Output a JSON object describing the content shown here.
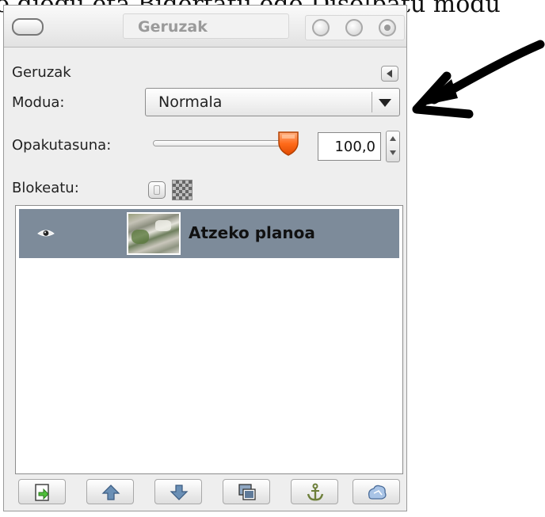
{
  "background_text": "o diogu eta Bidertatu edo Disolbatu modu",
  "window": {
    "title": "Geruzak"
  },
  "panel": {
    "title": "Geruzak",
    "mode_label": "Modua:",
    "mode_value": "Normala",
    "opacity_label": "Opakutasuna:",
    "opacity_value": "100,0",
    "opacity_fraction": 1.0,
    "lock_label": "Blokeatu:"
  },
  "layers": [
    {
      "name": "Atzeko planoa",
      "visible": true,
      "selected": true
    }
  ],
  "bottom_buttons": [
    {
      "icon": "new-layer-icon"
    },
    {
      "icon": "raise-layer-icon"
    },
    {
      "icon": "lower-layer-icon"
    },
    {
      "icon": "duplicate-layer-icon"
    },
    {
      "icon": "anchor-icon"
    },
    {
      "icon": "delete-layer-icon"
    }
  ],
  "colors": {
    "selected_row": "#7d8b9a",
    "slider_thumb": "#ff6a1a",
    "annotation_arrow": "#000000"
  }
}
